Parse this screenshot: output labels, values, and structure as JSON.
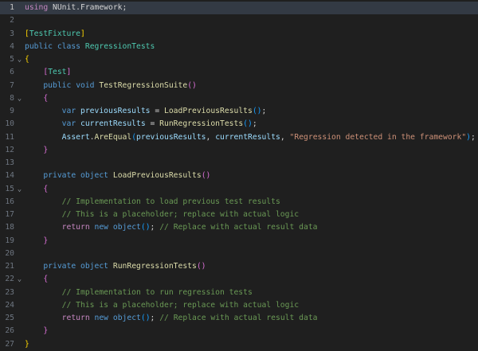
{
  "editor": {
    "language": "C#",
    "active_line": 1,
    "fold_icon": "⌄",
    "fold_lines": [
      5,
      8,
      15,
      22
    ],
    "ui": {
      "background": "#1f1f1f",
      "active_line_bg": "#333a44",
      "line_number": "#6e7681",
      "line_number_active": "#c6c6c6",
      "fold_icon_color": "#8a9199"
    },
    "token_colors": {
      "kw": "#C586C0",
      "kwb": "#569CD6",
      "type": "#4EC9B0",
      "fn": "#DCDCAA",
      "var": "#9CDCFE",
      "str": "#CE9178",
      "com": "#6A9955",
      "pl": "#D4D4D4",
      "b1": "#FFD700",
      "b2": "#DA70D6",
      "b3": "#179FFF"
    },
    "lines": [
      {
        "n": 1,
        "tokens": [
          [
            "kw",
            "using"
          ],
          [
            "pl",
            " "
          ],
          [
            "pl",
            "NUnit.Framework;"
          ]
        ]
      },
      {
        "n": 2,
        "tokens": []
      },
      {
        "n": 3,
        "tokens": [
          [
            "b1",
            "["
          ],
          [
            "type",
            "TestFixture"
          ],
          [
            "b1",
            "]"
          ]
        ]
      },
      {
        "n": 4,
        "tokens": [
          [
            "kwb",
            "public"
          ],
          [
            "pl",
            " "
          ],
          [
            "kwb",
            "class"
          ],
          [
            "pl",
            " "
          ],
          [
            "type",
            "RegressionTests"
          ]
        ]
      },
      {
        "n": 5,
        "tokens": [
          [
            "b1",
            "{"
          ]
        ]
      },
      {
        "n": 6,
        "tokens": [
          [
            "pl",
            "    "
          ],
          [
            "b2",
            "["
          ],
          [
            "type",
            "Test"
          ],
          [
            "b2",
            "]"
          ]
        ]
      },
      {
        "n": 7,
        "tokens": [
          [
            "pl",
            "    "
          ],
          [
            "kwb",
            "public"
          ],
          [
            "pl",
            " "
          ],
          [
            "kwb",
            "void"
          ],
          [
            "pl",
            " "
          ],
          [
            "fn",
            "TestRegressionSuite"
          ],
          [
            "b2",
            "()"
          ]
        ]
      },
      {
        "n": 8,
        "tokens": [
          [
            "pl",
            "    "
          ],
          [
            "b2",
            "{"
          ]
        ]
      },
      {
        "n": 9,
        "tokens": [
          [
            "pl",
            "        "
          ],
          [
            "kwb",
            "var"
          ],
          [
            "pl",
            " "
          ],
          [
            "var",
            "previousResults"
          ],
          [
            "pl",
            " = "
          ],
          [
            "fn",
            "LoadPreviousResults"
          ],
          [
            "b3",
            "()"
          ],
          [
            "pl",
            ";"
          ]
        ]
      },
      {
        "n": 10,
        "tokens": [
          [
            "pl",
            "        "
          ],
          [
            "kwb",
            "var"
          ],
          [
            "pl",
            " "
          ],
          [
            "var",
            "currentResults"
          ],
          [
            "pl",
            " = "
          ],
          [
            "fn",
            "RunRegressionTests"
          ],
          [
            "b3",
            "()"
          ],
          [
            "pl",
            ";"
          ]
        ]
      },
      {
        "n": 11,
        "tokens": [
          [
            "pl",
            "        "
          ],
          [
            "var",
            "Assert"
          ],
          [
            "pl",
            "."
          ],
          [
            "fn",
            "AreEqual"
          ],
          [
            "b3",
            "("
          ],
          [
            "var",
            "previousResults"
          ],
          [
            "pl",
            ", "
          ],
          [
            "var",
            "currentResults"
          ],
          [
            "pl",
            ", "
          ],
          [
            "str",
            "\"Regression detected in the framework\""
          ],
          [
            "b3",
            ")"
          ],
          [
            "pl",
            ";"
          ]
        ]
      },
      {
        "n": 12,
        "tokens": [
          [
            "pl",
            "    "
          ],
          [
            "b2",
            "}"
          ]
        ]
      },
      {
        "n": 13,
        "tokens": []
      },
      {
        "n": 14,
        "tokens": [
          [
            "pl",
            "    "
          ],
          [
            "kwb",
            "private"
          ],
          [
            "pl",
            " "
          ],
          [
            "kwb",
            "object"
          ],
          [
            "pl",
            " "
          ],
          [
            "fn",
            "LoadPreviousResults"
          ],
          [
            "b2",
            "()"
          ]
        ]
      },
      {
        "n": 15,
        "tokens": [
          [
            "pl",
            "    "
          ],
          [
            "b2",
            "{"
          ]
        ]
      },
      {
        "n": 16,
        "tokens": [
          [
            "pl",
            "        "
          ],
          [
            "com",
            "// Implementation to load previous test results"
          ]
        ]
      },
      {
        "n": 17,
        "tokens": [
          [
            "pl",
            "        "
          ],
          [
            "com",
            "// This is a placeholder; replace with actual logic"
          ]
        ]
      },
      {
        "n": 18,
        "tokens": [
          [
            "pl",
            "        "
          ],
          [
            "kw",
            "return"
          ],
          [
            "pl",
            " "
          ],
          [
            "kwb",
            "new"
          ],
          [
            "pl",
            " "
          ],
          [
            "kwb",
            "object"
          ],
          [
            "b3",
            "()"
          ],
          [
            "pl",
            "; "
          ],
          [
            "com",
            "// Replace with actual result data"
          ]
        ]
      },
      {
        "n": 19,
        "tokens": [
          [
            "pl",
            "    "
          ],
          [
            "b2",
            "}"
          ]
        ]
      },
      {
        "n": 20,
        "tokens": []
      },
      {
        "n": 21,
        "tokens": [
          [
            "pl",
            "    "
          ],
          [
            "kwb",
            "private"
          ],
          [
            "pl",
            " "
          ],
          [
            "kwb",
            "object"
          ],
          [
            "pl",
            " "
          ],
          [
            "fn",
            "RunRegressionTests"
          ],
          [
            "b2",
            "()"
          ]
        ]
      },
      {
        "n": 22,
        "tokens": [
          [
            "pl",
            "    "
          ],
          [
            "b2",
            "{"
          ]
        ]
      },
      {
        "n": 23,
        "tokens": [
          [
            "pl",
            "        "
          ],
          [
            "com",
            "// Implementation to run regression tests"
          ]
        ]
      },
      {
        "n": 24,
        "tokens": [
          [
            "pl",
            "        "
          ],
          [
            "com",
            "// This is a placeholder; replace with actual logic"
          ]
        ]
      },
      {
        "n": 25,
        "tokens": [
          [
            "pl",
            "        "
          ],
          [
            "kw",
            "return"
          ],
          [
            "pl",
            " "
          ],
          [
            "kwb",
            "new"
          ],
          [
            "pl",
            " "
          ],
          [
            "kwb",
            "object"
          ],
          [
            "b3",
            "()"
          ],
          [
            "pl",
            "; "
          ],
          [
            "com",
            "// Replace with actual result data"
          ]
        ]
      },
      {
        "n": 26,
        "tokens": [
          [
            "pl",
            "    "
          ],
          [
            "b2",
            "}"
          ]
        ]
      },
      {
        "n": 27,
        "tokens": [
          [
            "b1",
            "}"
          ]
        ]
      }
    ]
  }
}
